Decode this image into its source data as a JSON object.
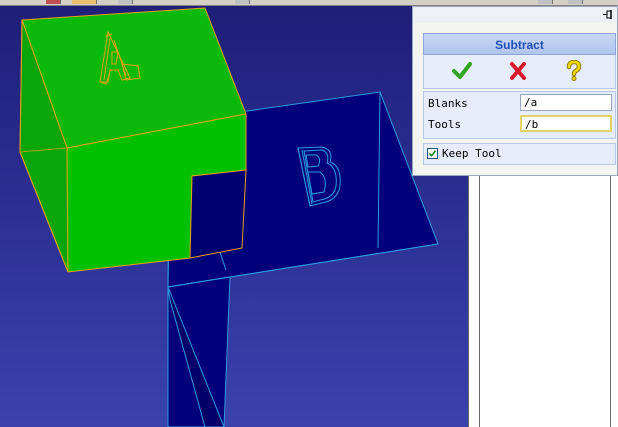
{
  "panel": {
    "title": "Subtract",
    "actions": [
      {
        "name": "ok",
        "icon": "checkmark-icon",
        "color": "#2fa51f"
      },
      {
        "name": "cancel",
        "icon": "x-icon",
        "color": "#d8192a"
      },
      {
        "name": "help",
        "icon": "question-icon",
        "color": "#e6c800"
      }
    ],
    "fields": [
      {
        "label": "Blanks",
        "value": "/a"
      },
      {
        "label": "Tools",
        "value": "/b"
      }
    ],
    "keep_tool": {
      "label": "Keep Tool",
      "checked": true
    }
  },
  "scene": {
    "background_top": "#23237c",
    "background_bottom": "#3b42b0",
    "blank_color": "#0ab90a",
    "blank_edge_color": "#e8a018",
    "tool_color": "#00007a",
    "tool_edge_color": "#2a9ae0",
    "blank_glyph": "A",
    "tool_glyph": "B"
  }
}
